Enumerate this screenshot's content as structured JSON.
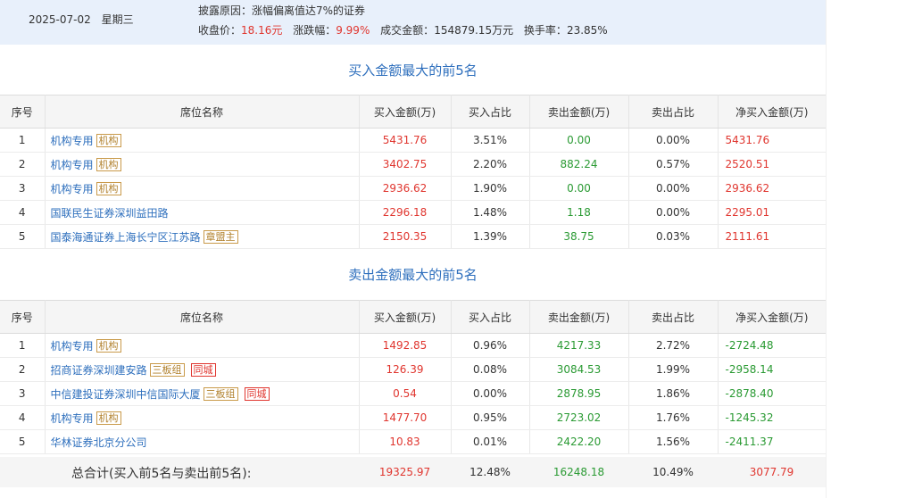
{
  "header": {
    "date": "2025-07-02",
    "weekday": "星期三",
    "reason": "披露原因：涨幅偏离值达7%的证券",
    "close_label": "收盘价：",
    "close_value": "18.16元",
    "change_label": "涨跌幅：",
    "change_value": "9.99%",
    "turnover_label": "成交金额：",
    "turnover_value": "154879.15万元",
    "rate_label": "换手率：",
    "rate_value": "23.85%"
  },
  "columns": [
    "序号",
    "席位名称",
    "买入金额(万)",
    "买入占比",
    "卖出金额(万)",
    "卖出占比",
    "净买入金额(万)"
  ],
  "buy_section": {
    "title": "买入金额最大的前5名",
    "rows": [
      {
        "no": "1",
        "name": "机构专用",
        "tags": [
          "机构"
        ],
        "buy": "5431.76",
        "buy_pct": "3.51%",
        "sell": "0.00",
        "sell_pct": "0.00%",
        "net": "5431.76",
        "net_color": "red"
      },
      {
        "no": "2",
        "name": "机构专用",
        "tags": [
          "机构"
        ],
        "buy": "3402.75",
        "buy_pct": "2.20%",
        "sell": "882.24",
        "sell_pct": "0.57%",
        "net": "2520.51",
        "net_color": "red"
      },
      {
        "no": "3",
        "name": "机构专用",
        "tags": [
          "机构"
        ],
        "buy": "2936.62",
        "buy_pct": "1.90%",
        "sell": "0.00",
        "sell_pct": "0.00%",
        "net": "2936.62",
        "net_color": "red"
      },
      {
        "no": "4",
        "name": "国联民生证券深圳益田路",
        "tags": [],
        "buy": "2296.18",
        "buy_pct": "1.48%",
        "sell": "1.18",
        "sell_pct": "0.00%",
        "net": "2295.01",
        "net_color": "red"
      },
      {
        "no": "5",
        "name": "国泰海通证券上海长宁区江苏路",
        "tags": [
          "章盟主"
        ],
        "buy": "2150.35",
        "buy_pct": "1.39%",
        "sell": "38.75",
        "sell_pct": "0.03%",
        "net": "2111.61",
        "net_color": "red"
      }
    ]
  },
  "sell_section": {
    "title": "卖出金额最大的前5名",
    "rows": [
      {
        "no": "1",
        "name": "机构专用",
        "tags": [
          "机构"
        ],
        "city": "",
        "buy": "1492.85",
        "buy_pct": "0.96%",
        "sell": "4217.33",
        "sell_pct": "2.72%",
        "net": "-2724.48",
        "net_color": "green"
      },
      {
        "no": "2",
        "name": "招商证券深圳建安路",
        "tags": [
          "三板组"
        ],
        "city": "同城",
        "buy": "126.39",
        "buy_pct": "0.08%",
        "sell": "3084.53",
        "sell_pct": "1.99%",
        "net": "-2958.14",
        "net_color": "green"
      },
      {
        "no": "3",
        "name": "中信建投证券深圳中信国际大厦",
        "tags": [
          "三板组"
        ],
        "city": "同城",
        "buy": "0.54",
        "buy_pct": "0.00%",
        "sell": "2878.95",
        "sell_pct": "1.86%",
        "net": "-2878.40",
        "net_color": "green"
      },
      {
        "no": "4",
        "name": "机构专用",
        "tags": [
          "机构"
        ],
        "city": "",
        "buy": "1477.70",
        "buy_pct": "0.95%",
        "sell": "2723.02",
        "sell_pct": "1.76%",
        "net": "-1245.32",
        "net_color": "green"
      },
      {
        "no": "5",
        "name": "华林证券北京分公司",
        "tags": [],
        "city": "",
        "buy": "10.83",
        "buy_pct": "0.01%",
        "sell": "2422.20",
        "sell_pct": "1.56%",
        "net": "-2411.37",
        "net_color": "green"
      }
    ]
  },
  "total": {
    "label": "总合计(买入前5名与卖出前5名):",
    "buy": "19325.97",
    "buy_pct": "12.48%",
    "sell": "16248.18",
    "sell_pct": "10.49%",
    "net": "3077.79"
  },
  "colors": {
    "up": "#e0362f",
    "down": "#2a9a33",
    "link": "#2e6fbd",
    "header_bg": "#e8f0fb"
  }
}
